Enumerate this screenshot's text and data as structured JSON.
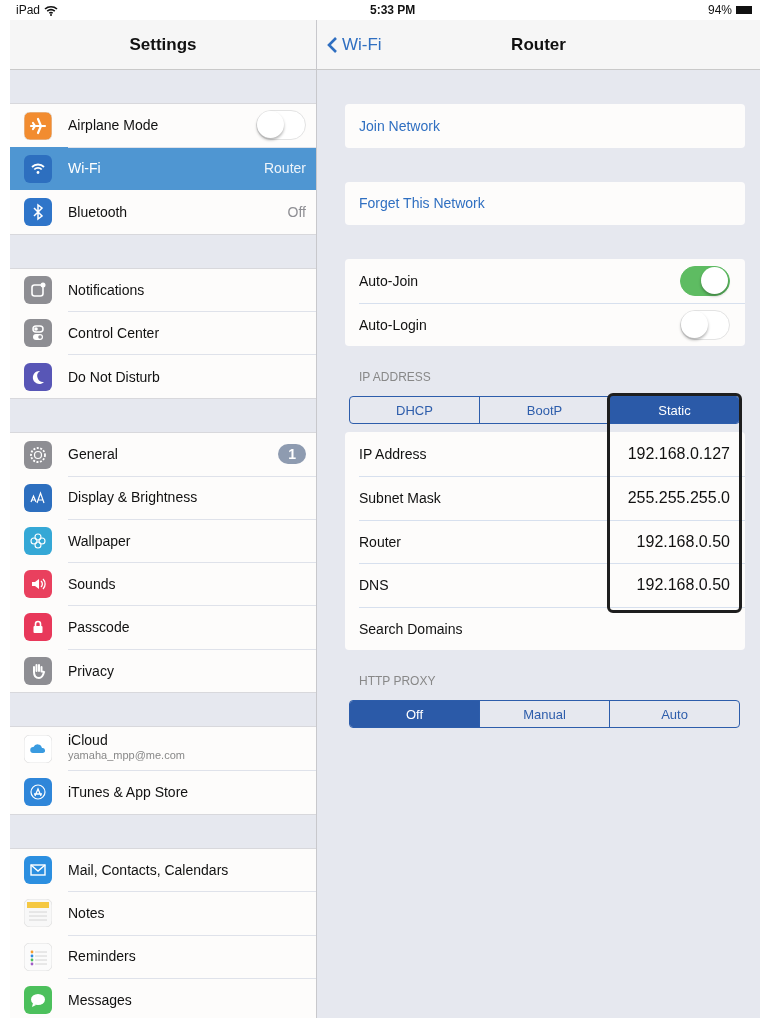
{
  "status_bar": {
    "carrier": "iPad",
    "time": "5:33 PM",
    "battery": "94%"
  },
  "sidebar": {
    "title": "Settings",
    "groups": [
      [
        {
          "kind": "toggle",
          "label": "Airplane Mode",
          "on": false,
          "selected": false
        },
        {
          "kind": "value",
          "label": "Wi-Fi",
          "value": "Router",
          "selected": true
        },
        {
          "kind": "value",
          "label": "Bluetooth",
          "value": "Off",
          "selected": false
        }
      ],
      [
        {
          "kind": "plain",
          "label": "Notifications",
          "selected": false
        },
        {
          "kind": "plain",
          "label": "Control Center",
          "selected": false
        },
        {
          "kind": "plain",
          "label": "Do Not Disturb",
          "selected": false
        }
      ],
      [
        {
          "kind": "badge",
          "label": "General",
          "badge": "1",
          "selected": false
        },
        {
          "kind": "plain",
          "label": "Display & Brightness",
          "selected": false
        },
        {
          "kind": "plain",
          "label": "Wallpaper",
          "selected": false
        },
        {
          "kind": "plain",
          "label": "Sounds",
          "selected": false
        },
        {
          "kind": "plain",
          "label": "Passcode",
          "selected": false
        },
        {
          "kind": "plain",
          "label": "Privacy",
          "selected": false
        }
      ],
      [
        {
          "kind": "account",
          "label": "iCloud",
          "subtitle": "yamaha_mpp@me.com",
          "selected": false
        },
        {
          "kind": "plain",
          "label": "iTunes & App Store",
          "selected": false
        }
      ],
      [
        {
          "kind": "plain",
          "label": "Mail, Contacts, Calendars",
          "selected": false
        },
        {
          "kind": "plain",
          "label": "Notes",
          "selected": false
        },
        {
          "kind": "plain",
          "label": "Reminders",
          "selected": false
        },
        {
          "kind": "plain",
          "label": "Messages",
          "selected": false
        }
      ]
    ]
  },
  "detail": {
    "back": "Wi-Fi",
    "title": "Router",
    "actions": [
      "Join Network",
      "Forget This Network"
    ],
    "toggles": [
      {
        "label": "Auto-Join",
        "on": true
      },
      {
        "label": "Auto-Login",
        "on": false
      }
    ],
    "ip_address": {
      "header": "IP ADDRESS",
      "modes": [
        {
          "label": "DHCP",
          "selected": false
        },
        {
          "label": "BootP",
          "selected": false
        },
        {
          "label": "Static",
          "selected": true
        }
      ],
      "fields": [
        {
          "label": "IP Address",
          "value": "192.168.0.127"
        },
        {
          "label": "Subnet Mask",
          "value": "255.255.255.0"
        },
        {
          "label": "Router",
          "value": "192.168.0.50"
        },
        {
          "label": "DNS",
          "value": "192.168.0.50"
        },
        {
          "label": "Search Domains"
        }
      ]
    },
    "http_proxy": {
      "header": "HTTP PROXY",
      "modes": [
        {
          "label": "Off",
          "selected": true
        },
        {
          "label": "Manual",
          "selected": false
        },
        {
          "label": "Auto",
          "selected": false
        }
      ]
    }
  }
}
